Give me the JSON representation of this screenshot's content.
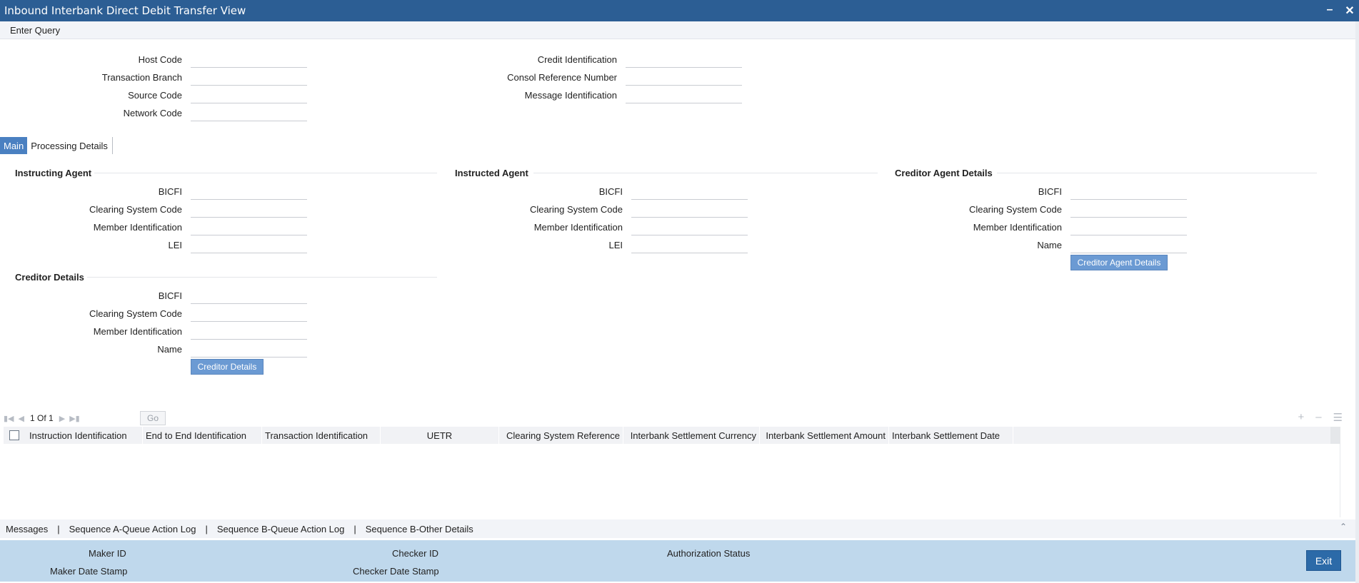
{
  "window": {
    "title": "Inbound Interbank Direct Debit Transfer View",
    "minimize_icon": "minimize-icon",
    "close_icon": "close-icon"
  },
  "menu": {
    "enter_query": "Enter Query"
  },
  "header_fields": {
    "left": [
      {
        "label": "Host Code",
        "value": ""
      },
      {
        "label": "Transaction Branch",
        "value": ""
      },
      {
        "label": "Source Code",
        "value": ""
      },
      {
        "label": "Network Code",
        "value": ""
      }
    ],
    "right": [
      {
        "label": "Credit Identification",
        "value": ""
      },
      {
        "label": "Consol Reference Number",
        "value": ""
      },
      {
        "label": "Message Identification",
        "value": ""
      }
    ]
  },
  "tabs": [
    {
      "label": "Main",
      "active": true
    },
    {
      "label": "Processing Details",
      "active": false
    }
  ],
  "sections": {
    "instructing_agent": {
      "title": "Instructing Agent",
      "fields": [
        {
          "label": "BICFI",
          "value": ""
        },
        {
          "label": "Clearing System Code",
          "value": ""
        },
        {
          "label": "Member Identification",
          "value": ""
        },
        {
          "label": "LEI",
          "value": ""
        }
      ]
    },
    "instructed_agent": {
      "title": "Instructed Agent",
      "fields": [
        {
          "label": "BICFI",
          "value": ""
        },
        {
          "label": "Clearing System Code",
          "value": ""
        },
        {
          "label": "Member Identification",
          "value": ""
        },
        {
          "label": "LEI",
          "value": ""
        }
      ]
    },
    "creditor_agent": {
      "title": "Creditor Agent Details",
      "fields": [
        {
          "label": "BICFI",
          "value": ""
        },
        {
          "label": "Clearing System Code",
          "value": ""
        },
        {
          "label": "Member Identification",
          "value": ""
        },
        {
          "label": "Name",
          "value": ""
        }
      ],
      "button": "Creditor Agent Details"
    },
    "creditor": {
      "title": "Creditor Details",
      "fields": [
        {
          "label": "BICFI",
          "value": ""
        },
        {
          "label": "Clearing System Code",
          "value": ""
        },
        {
          "label": "Member Identification",
          "value": ""
        },
        {
          "label": "Name",
          "value": ""
        }
      ],
      "button": "Creditor Details"
    }
  },
  "pager": {
    "page": "1",
    "of_label": "Of",
    "total": "1",
    "go_label": "Go"
  },
  "grid": {
    "columns": [
      "Instruction Identification",
      "End to End Identification",
      "Transaction Identification",
      "UETR",
      "Clearing System Reference",
      "Interbank Settlement Currency",
      "Interbank Settlement Amount",
      "Interbank Settlement Date"
    ],
    "rows": []
  },
  "bottom_nav": [
    "Messages",
    "Sequence A-Queue Action Log",
    "Sequence B-Queue Action Log",
    "Sequence B-Other Details"
  ],
  "audit": {
    "maker_id": "Maker ID",
    "maker_date_stamp": "Maker Date Stamp",
    "checker_id": "Checker ID",
    "checker_date_stamp": "Checker Date Stamp",
    "authorization_status": "Authorization Status"
  },
  "exit_label": "Exit",
  "colors": {
    "titlebar": "#2c5e94",
    "tab_active": "#4a80c1",
    "button": "#6b9ad3",
    "audit_bar": "#bfd8ec",
    "exit_button": "#2c6aa8"
  }
}
